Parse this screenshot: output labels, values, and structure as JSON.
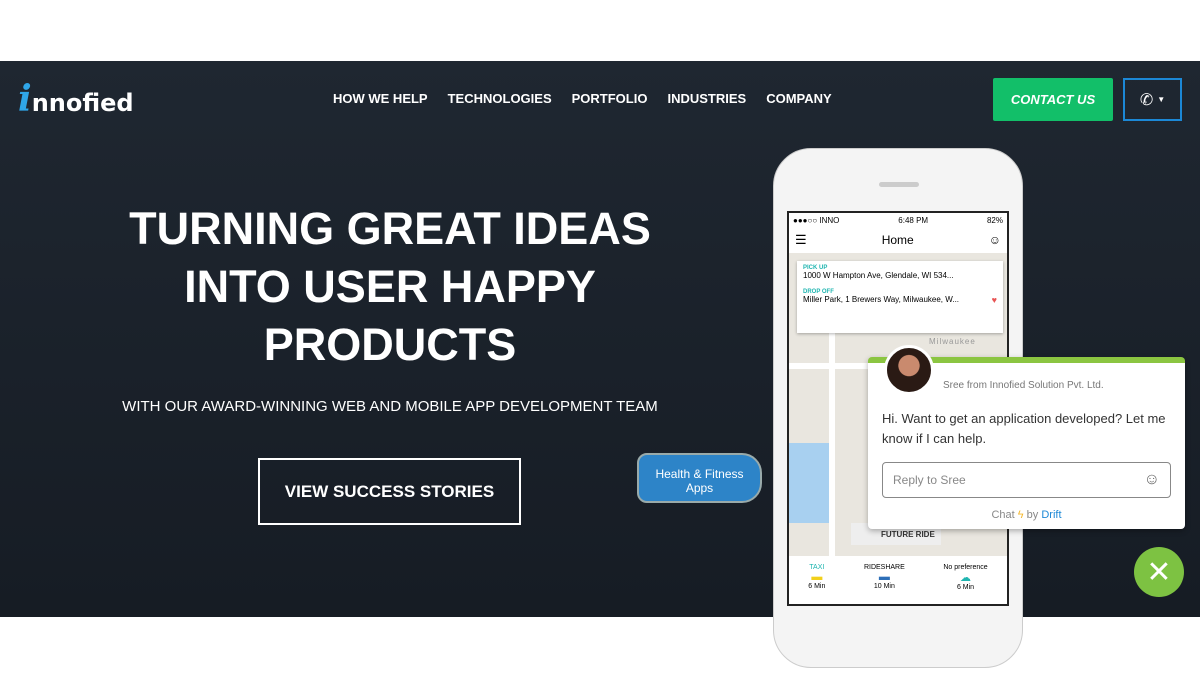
{
  "brand": {
    "logo_i": "i",
    "logo_rest": "nnofied"
  },
  "nav": [
    "HOW WE HELP",
    "TECHNOLOGIES",
    "PORTFOLIO",
    "INDUSTRIES",
    "COMPANY"
  ],
  "contact_label": "CONTACT US",
  "hero": {
    "line1": "TURNING GREAT IDEAS",
    "line2": "INTO USER HAPPY",
    "line3": "PRODUCTS",
    "subtitle": "WITH OUR AWARD-WINNING WEB AND MOBILE APP DEVELOPMENT TEAM",
    "cta": "VIEW SUCCESS STORIES"
  },
  "phone": {
    "carrier": "●●●○○ INNO",
    "time": "6:48 PM",
    "battery": "82%",
    "title": "Home",
    "pickup_label": "PICK UP",
    "pickup": "1000 W Hampton Ave, Glendale, WI 534...",
    "dropoff_label": "DROP OFF",
    "dropoff": "Miller Park, 1 Brewers Way, Milwaukee, W...",
    "map_label": "Milwaukee",
    "future": "FUTURE RIDE",
    "options": [
      {
        "name": "TAXI",
        "eta": "6 Min"
      },
      {
        "name": "RIDESHARE",
        "eta": "10 Min"
      },
      {
        "name": "No preference",
        "eta": "6 Min"
      }
    ]
  },
  "bubble": {
    "line1": "Health & Fitness",
    "line2": "Apps"
  },
  "chat": {
    "from": "Sree from Innofied Solution Pvt. Ltd.",
    "message": "Hi. Want to get an application developed? Let me know if I can help.",
    "placeholder": "Reply to Sree",
    "powered_chat": "Chat",
    "powered_by": "by",
    "powered_brand": "Drift"
  },
  "colors": {
    "accent_green": "#12bf69",
    "chat_green": "#8bc541",
    "blue": "#1c88d6"
  }
}
